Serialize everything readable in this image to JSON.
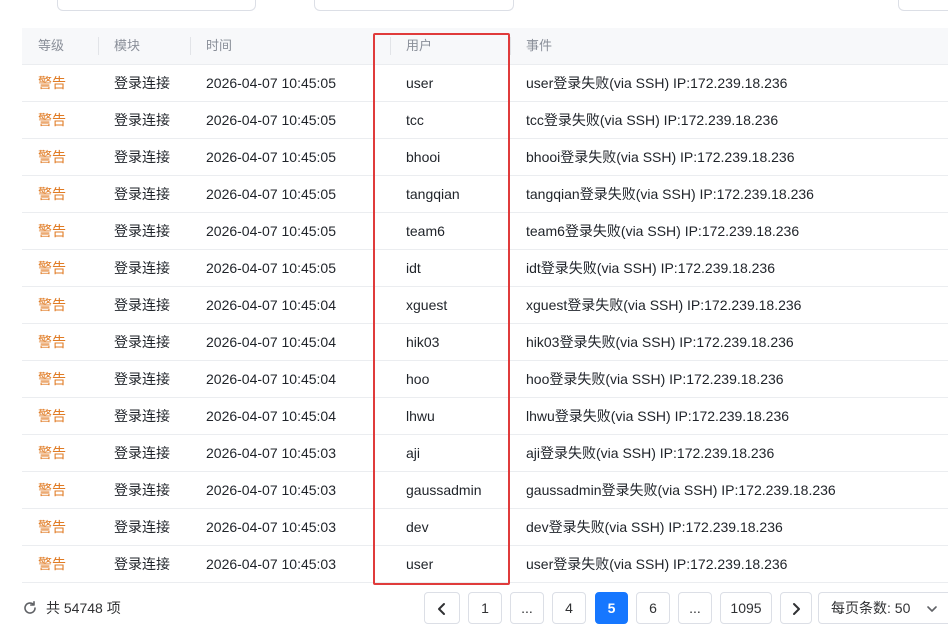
{
  "table": {
    "headers": {
      "level": "等级",
      "module": "模块",
      "time": "时间",
      "user": "用户",
      "event": "事件"
    },
    "rows": [
      {
        "level": "警告",
        "module": "登录连接",
        "time": "2026-04-07 10:45:05",
        "user": "user",
        "event": "user登录失败(via SSH) IP:172.239.18.236"
      },
      {
        "level": "警告",
        "module": "登录连接",
        "time": "2026-04-07 10:45:05",
        "user": "tcc",
        "event": "tcc登录失败(via SSH) IP:172.239.18.236"
      },
      {
        "level": "警告",
        "module": "登录连接",
        "time": "2026-04-07 10:45:05",
        "user": "bhooi",
        "event": "bhooi登录失败(via SSH) IP:172.239.18.236"
      },
      {
        "level": "警告",
        "module": "登录连接",
        "time": "2026-04-07 10:45:05",
        "user": "tangqian",
        "event": "tangqian登录失败(via SSH) IP:172.239.18.236"
      },
      {
        "level": "警告",
        "module": "登录连接",
        "time": "2026-04-07 10:45:05",
        "user": "team6",
        "event": "team6登录失败(via SSH) IP:172.239.18.236"
      },
      {
        "level": "警告",
        "module": "登录连接",
        "time": "2026-04-07 10:45:05",
        "user": "idt",
        "event": "idt登录失败(via SSH) IP:172.239.18.236"
      },
      {
        "level": "警告",
        "module": "登录连接",
        "time": "2026-04-07 10:45:04",
        "user": "xguest",
        "event": "xguest登录失败(via SSH) IP:172.239.18.236"
      },
      {
        "level": "警告",
        "module": "登录连接",
        "time": "2026-04-07 10:45:04",
        "user": "hik03",
        "event": "hik03登录失败(via SSH) IP:172.239.18.236"
      },
      {
        "level": "警告",
        "module": "登录连接",
        "time": "2026-04-07 10:45:04",
        "user": "hoo",
        "event": "hoo登录失败(via SSH) IP:172.239.18.236"
      },
      {
        "level": "警告",
        "module": "登录连接",
        "time": "2026-04-07 10:45:04",
        "user": "lhwu",
        "event": "lhwu登录失败(via SSH) IP:172.239.18.236"
      },
      {
        "level": "警告",
        "module": "登录连接",
        "time": "2026-04-07 10:45:03",
        "user": "aji",
        "event": "aji登录失败(via SSH) IP:172.239.18.236"
      },
      {
        "level": "警告",
        "module": "登录连接",
        "time": "2026-04-07 10:45:03",
        "user": "gaussadmin",
        "event": "gaussadmin登录失败(via SSH) IP:172.239.18.236"
      },
      {
        "level": "警告",
        "module": "登录连接",
        "time": "2026-04-07 10:45:03",
        "user": "dev",
        "event": "dev登录失败(via SSH) IP:172.239.18.236"
      },
      {
        "level": "警告",
        "module": "登录连接",
        "time": "2026-04-07 10:45:03",
        "user": "user",
        "event": "user登录失败(via SSH) IP:172.239.18.236"
      }
    ]
  },
  "footer": {
    "refresh_icon": "refresh-icon",
    "total_text": "共 54748 项",
    "pages": [
      "1",
      "...",
      "4",
      "5",
      "6",
      "...",
      "1095"
    ],
    "current_page": "5",
    "page_size_text": "每页条数: 50"
  },
  "colors": {
    "warning": "#e07b24",
    "accent": "#1677ff",
    "highlight": "#e03b3b"
  }
}
